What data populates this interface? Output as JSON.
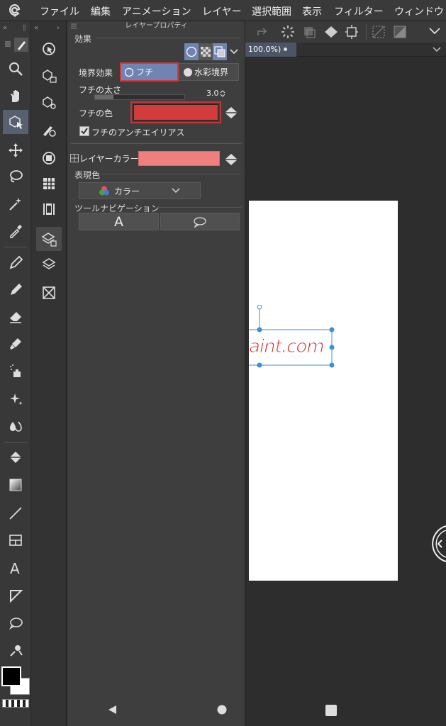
{
  "menu": {
    "items": [
      "ファイル",
      "編集",
      "アニメーション",
      "レイヤー",
      "選択範囲",
      "表示",
      "フィルター",
      "ウィンドウ"
    ]
  },
  "panel": {
    "title": "レイヤープロパティ",
    "section_effect": "効果",
    "border_effect_label": "境界効果",
    "border_option_fuchi": "フチ",
    "border_option_watercolor": "水彩境界",
    "thickness_label": "フチの太さ",
    "thickness_value": "3.0",
    "color_label": "フチの色",
    "antialias_label": "フチのアンチエイリアス",
    "antialias_checked": true,
    "layer_color_label": "レイヤーカラー",
    "expression_label": "表現色",
    "expression_value": "カラー",
    "tool_nav_label": "ツールナビゲーション",
    "tool_nav_text_glyph": "A"
  },
  "document": {
    "zoom": "100.0%)",
    "canvas_text": "aint.com"
  },
  "toolbar": {
    "text_tool_glyph": "A"
  },
  "colors": {
    "border_color": "#d23c3c",
    "layer_color": "#ef7f7f",
    "selection_blue": "#3c8fd8",
    "accent_blue": "#6f84b3",
    "main_color": "#000000",
    "sub_color": "#ffffff"
  }
}
